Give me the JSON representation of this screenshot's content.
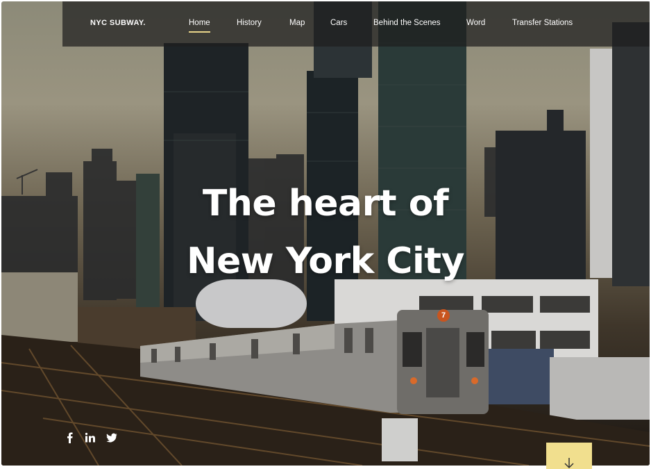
{
  "brand": {
    "name": "NYC SUBWAY."
  },
  "nav": {
    "items": [
      {
        "label": "Home",
        "active": true
      },
      {
        "label": "History"
      },
      {
        "label": "Map"
      },
      {
        "label": "Cars"
      },
      {
        "label": "Behind the Scenes"
      },
      {
        "label": "Word"
      },
      {
        "label": "Transfer Stations"
      }
    ]
  },
  "hero": {
    "headline_line1": "The heart of",
    "headline_line2": "New York City",
    "train_route_badge": "7"
  },
  "social": {
    "icons": [
      "facebook-icon",
      "linkedin-icon",
      "twitter-icon"
    ]
  },
  "scroll_button": {
    "icon": "arrow-down-icon"
  },
  "colors": {
    "accent": "#f1df8e",
    "nav_underline": "#e9d58a",
    "navbar_bg": "rgba(30,30,30,0.72)"
  }
}
